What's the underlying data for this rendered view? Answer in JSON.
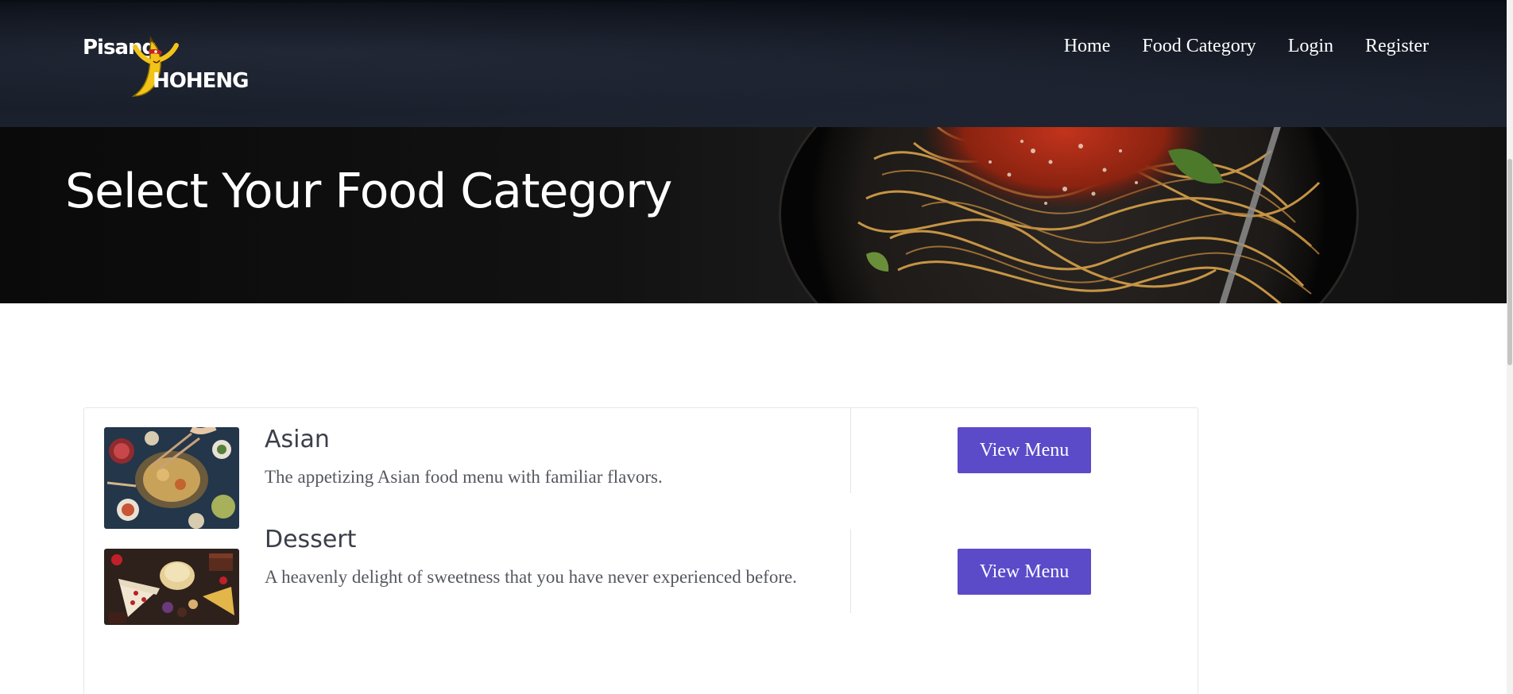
{
  "brand": {
    "line1": "Pisang",
    "line2": "HOHENG",
    "colors": {
      "banana": "#f2c318",
      "mask": "#c8201e"
    }
  },
  "nav": {
    "items": [
      {
        "label": "Home"
      },
      {
        "label": "Food Category"
      },
      {
        "label": "Login"
      },
      {
        "label": "Register"
      }
    ]
  },
  "hero": {
    "title": "Select Your Food Category"
  },
  "categories": [
    {
      "title": "Asian",
      "description": "The appetizing Asian food menu with familiar flavors.",
      "button_label": "View Menu",
      "image": "asian-food-image"
    },
    {
      "title": "Dessert",
      "description": "A heavenly delight of sweetness that you have never experienced before.",
      "button_label": "View Menu",
      "image": "dessert-food-image"
    }
  ],
  "colors": {
    "accent": "#5b4bc9",
    "navbar": "#161b26",
    "heading_text": "#3c3f4a",
    "body_text": "#555861"
  }
}
